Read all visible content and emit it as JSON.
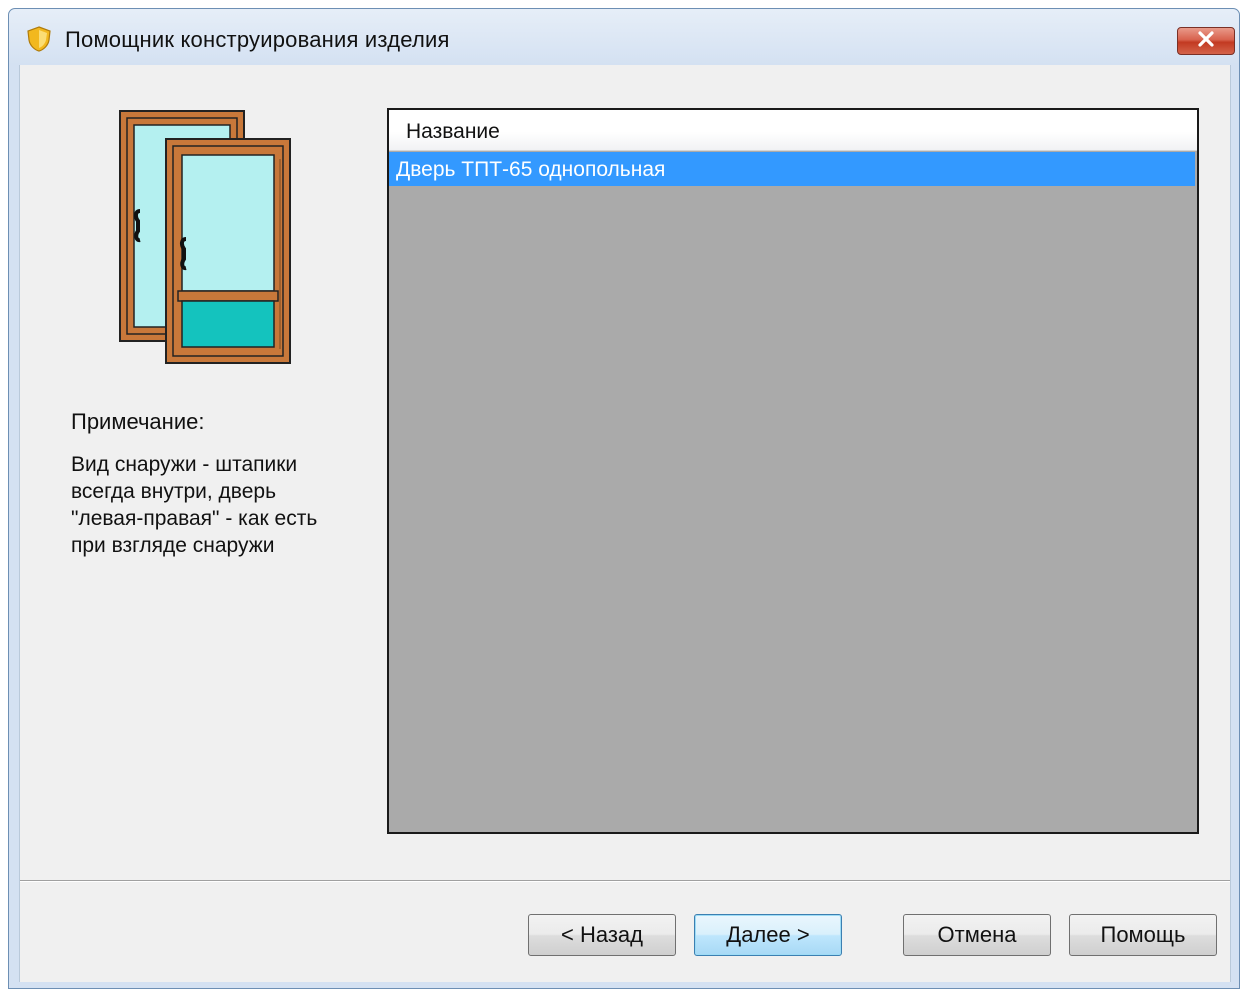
{
  "window": {
    "title": "Помощник конструирования изделия",
    "app_icon": "shield-icon",
    "close_icon": "close-icon"
  },
  "note": {
    "title": "Примечание:",
    "text": "Вид снаружи - штапики\nвсегда внутри, дверь\n\"левая-правая\" - как есть\nпри взгляде снаружи"
  },
  "list": {
    "column_header": "Название",
    "rows": [
      "Дверь ТПТ-65 однопольная"
    ],
    "selected_index": 0
  },
  "buttons": {
    "back": "< Назад",
    "next": "Далее >",
    "cancel": "Отмена",
    "help": "Помощь"
  },
  "colors": {
    "selection": "#3399ff",
    "list_background": "#aaaaaa",
    "door_frame": "#c8783a",
    "door_glass": "#b4f0f0",
    "door_panel": "#14c3be"
  }
}
